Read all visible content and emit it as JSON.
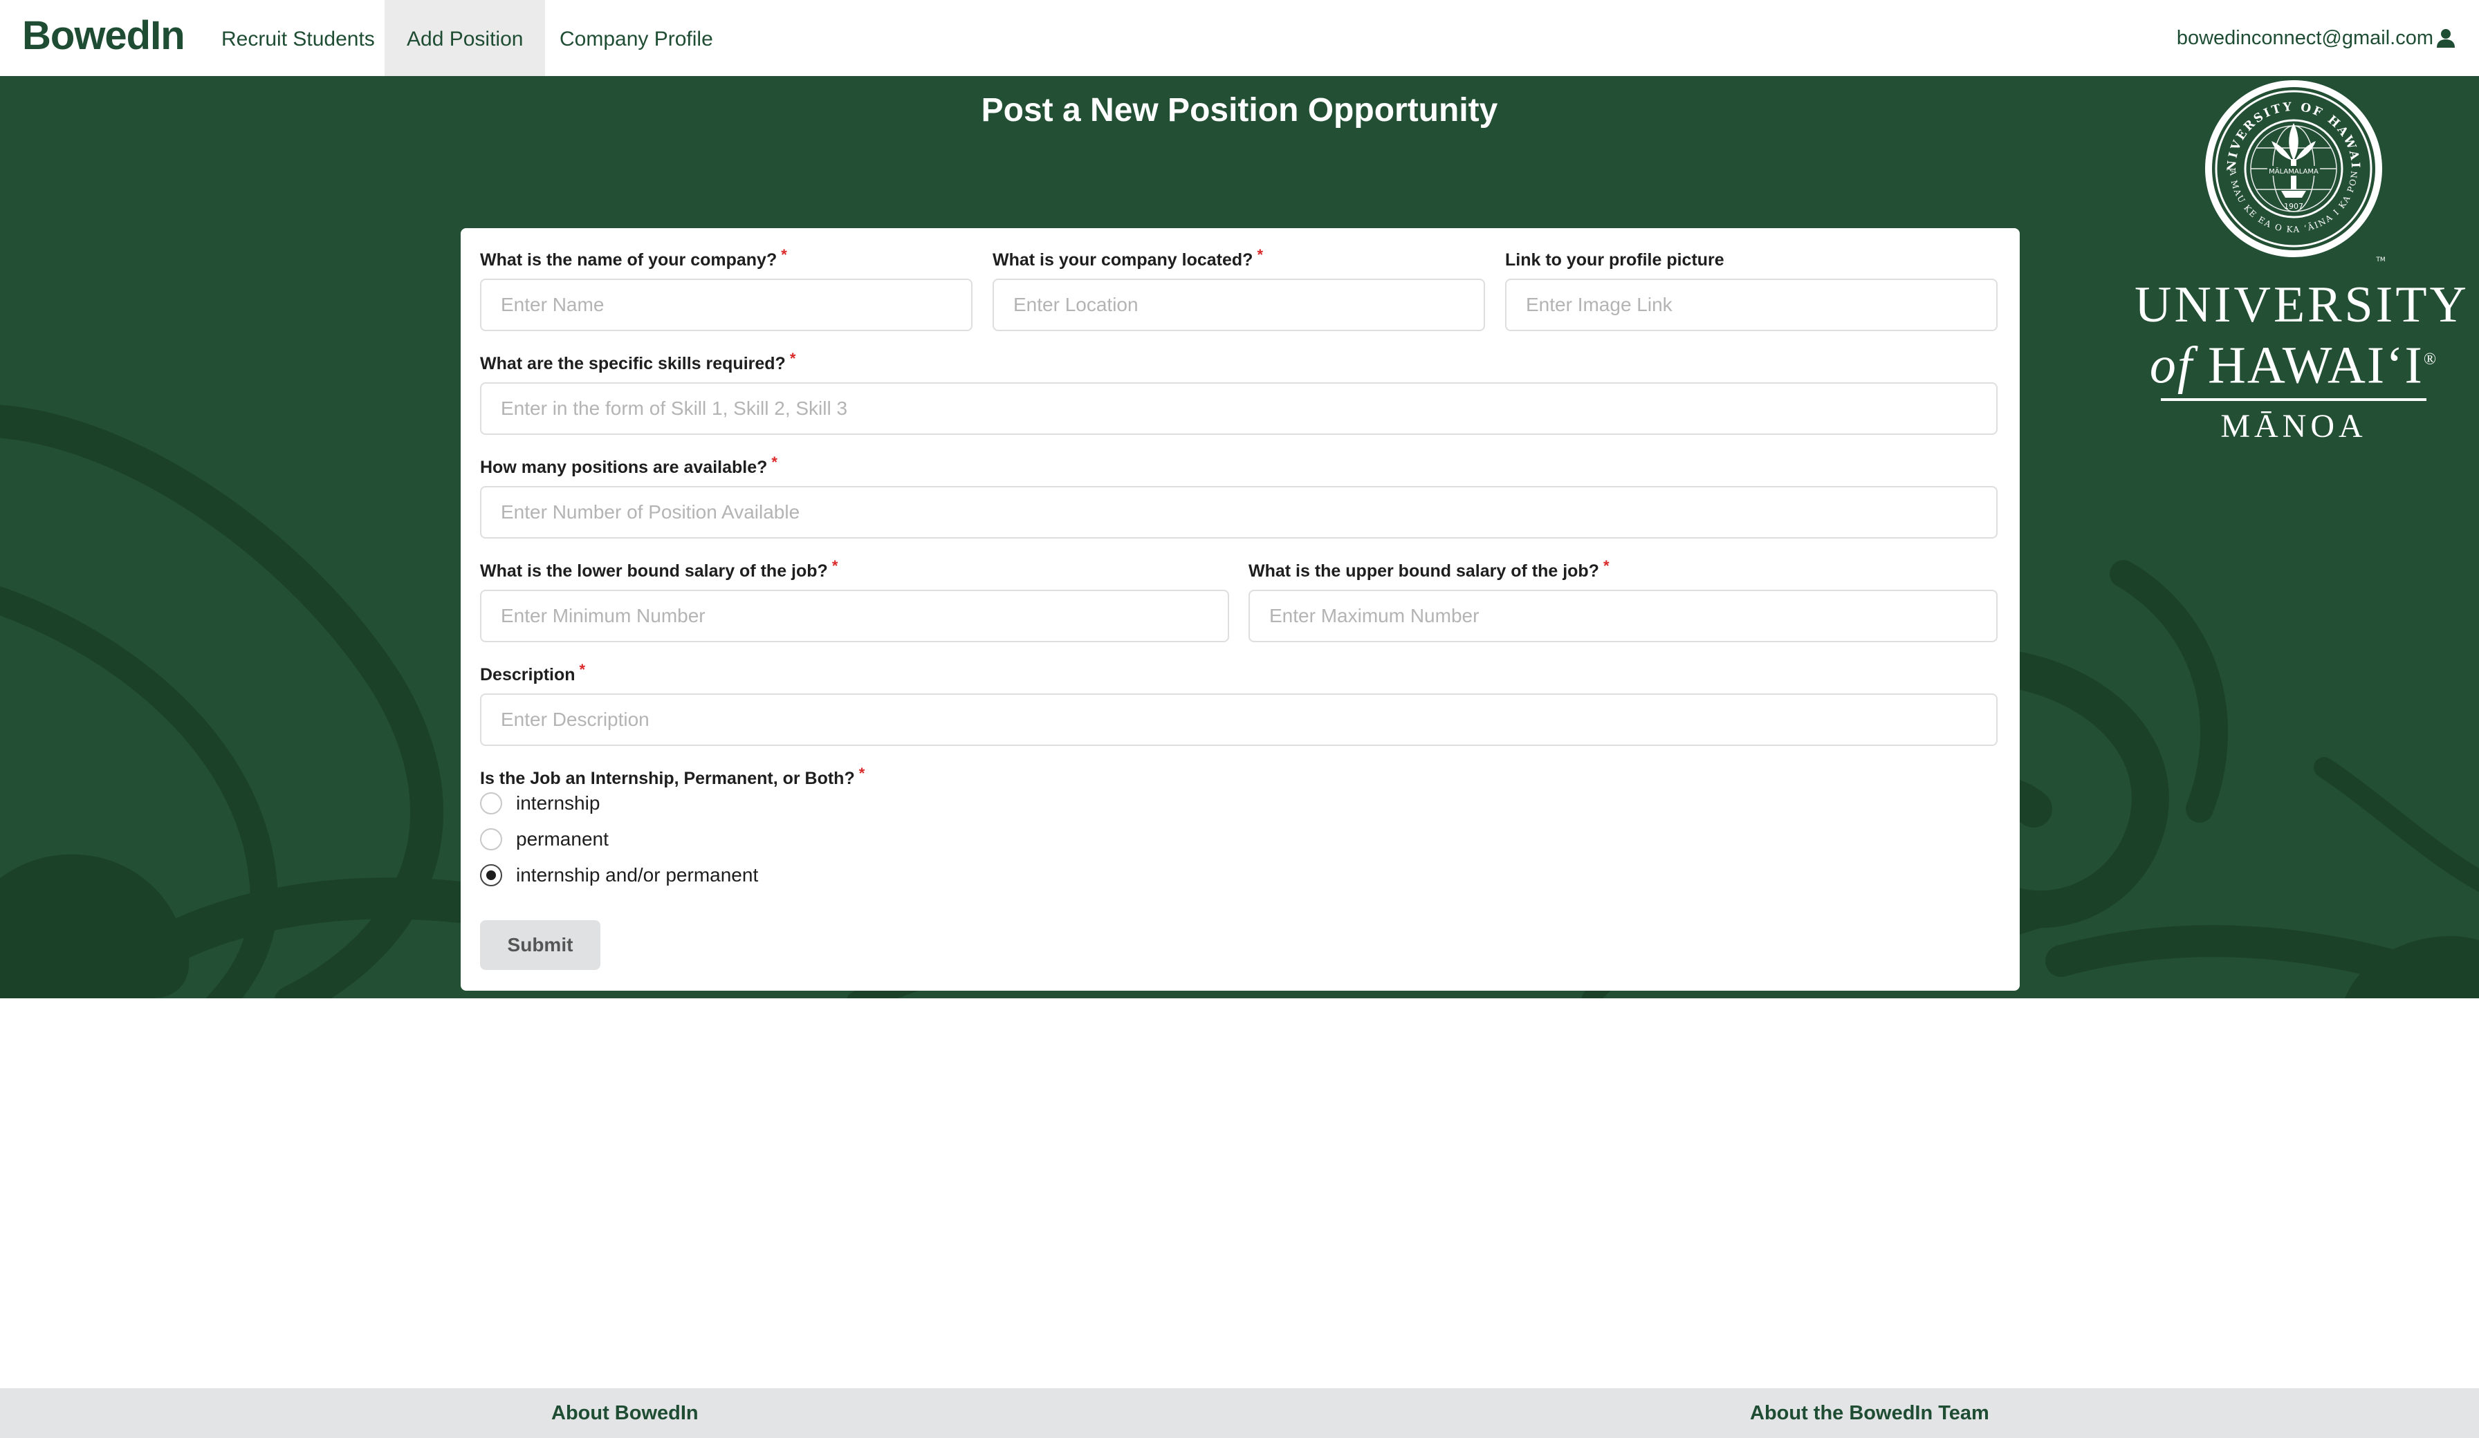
{
  "navbar": {
    "brand": "BowedIn",
    "items": [
      {
        "label": "Recruit Students",
        "active": false
      },
      {
        "label": "Add Position",
        "active": true
      },
      {
        "label": "Company Profile",
        "active": false
      }
    ],
    "user_email": "bowedinconnect@gmail.com",
    "user_icon": "user-icon"
  },
  "page": {
    "title": "Post a New Position Opportunity"
  },
  "logo": {
    "line1": "UNIVERSITY",
    "line2_of": "of",
    "line2_rest": "HAWAIʻI",
    "registered": "®",
    "line3": "MĀNOA",
    "seal_top_text": "UNIVERSITY OF HAWAIʻI",
    "seal_bottom_text": "UA MAU KE EA O KA ʻĀINA I KA PONO",
    "seal_banner_text": "MĀLAMALAMA",
    "seal_year": "1907",
    "trademark": "TM"
  },
  "form": {
    "required_mark": "*",
    "company_name": {
      "label": "What is the name of your company?",
      "placeholder": "Enter Name",
      "value": ""
    },
    "location": {
      "label": "What is your company located?",
      "placeholder": "Enter Location",
      "value": ""
    },
    "image_link": {
      "label": "Link to your profile picture",
      "placeholder": "Enter Image Link",
      "value": ""
    },
    "skills": {
      "label": "What are the specific skills required?",
      "placeholder": "Enter in the form of Skill 1, Skill 2, Skill 3",
      "value": ""
    },
    "positions": {
      "label": "How many positions are available?",
      "placeholder": "Enter Number of Position Available",
      "value": ""
    },
    "salary_min": {
      "label": "What is the lower bound salary of the job?",
      "placeholder": "Enter Minimum Number",
      "value": ""
    },
    "salary_max": {
      "label": "What is the upper bound salary of the job?",
      "placeholder": "Enter Maximum Number",
      "value": ""
    },
    "description": {
      "label": "Description",
      "placeholder": "Enter Description",
      "value": ""
    },
    "job_type": {
      "label": "Is the Job an Internship, Permanent, or Both?",
      "options": [
        {
          "label": "internship",
          "checked": false
        },
        {
          "label": "permanent",
          "checked": false
        },
        {
          "label": "internship and/or permanent",
          "checked": true
        }
      ]
    },
    "submit_label": "Submit"
  },
  "footer": {
    "about_label": "About BowedIn",
    "team_label": "About the BowedIn Team"
  },
  "colors": {
    "brand_green": "#1f4d34",
    "banner_green": "#234f35",
    "required_red": "#db2828",
    "button_grey": "#e0e1e2",
    "footer_grey": "#e3e4e5"
  }
}
